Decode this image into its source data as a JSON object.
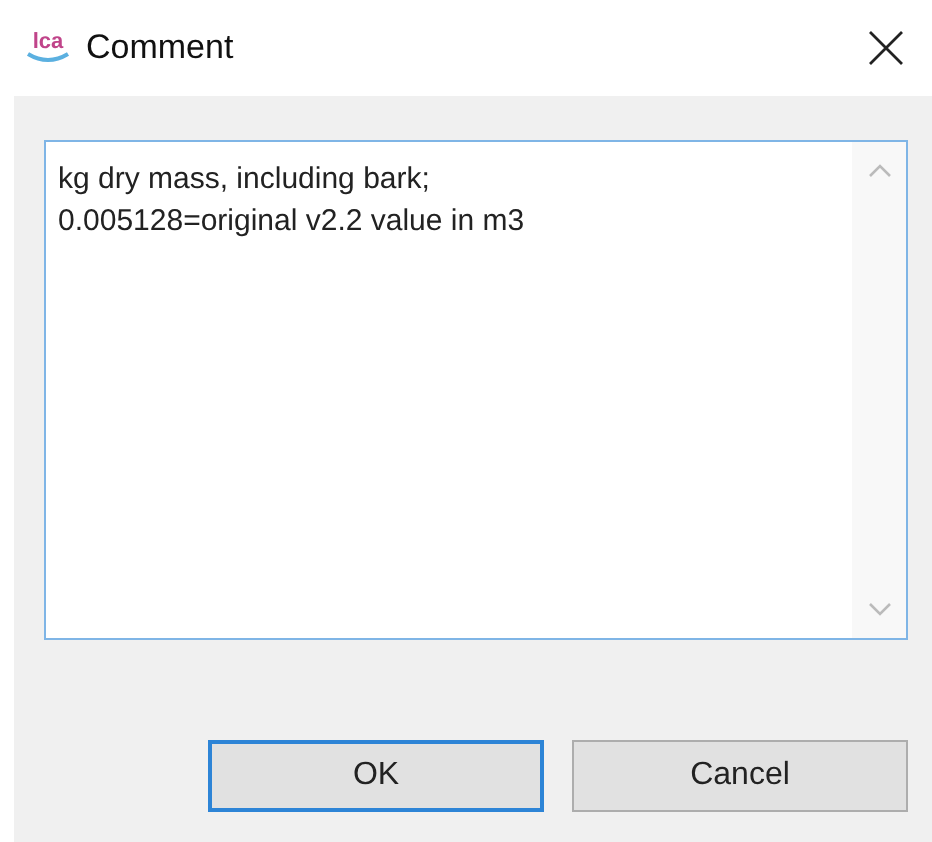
{
  "window": {
    "logo": "lca",
    "title": "Comment"
  },
  "comment": {
    "value": "kg dry mass, including bark;\n0.005128=original v2.2 value in m3"
  },
  "buttons": [
    {
      "label": "OK",
      "focused": true
    },
    {
      "label": "Cancel",
      "focused": false
    }
  ]
}
